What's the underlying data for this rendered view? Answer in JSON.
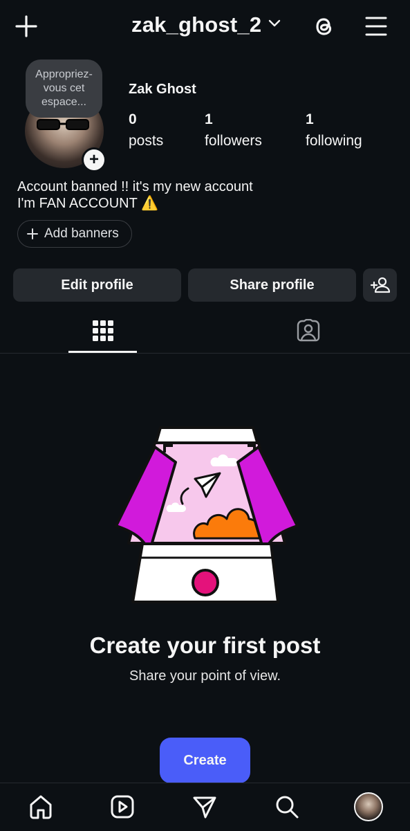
{
  "header": {
    "username": "zak_ghost_2",
    "icons": [
      "plus-icon",
      "chevron-down-icon",
      "threads-icon",
      "menu-icon"
    ]
  },
  "profile": {
    "note": "Appropriez-vous cet espace...",
    "display_name": "Zak Ghost",
    "stats": [
      {
        "value": "0",
        "label": "posts"
      },
      {
        "value": "1",
        "label": "followers"
      },
      {
        "value": "1",
        "label": "following"
      }
    ],
    "bio_line1": "Account banned !! it's my new account",
    "bio_line2": "I'm FAN ACCOUNT ⚠️",
    "add_banners": "Add banners"
  },
  "actions": {
    "edit_profile": "Edit profile",
    "share_profile": "Share profile"
  },
  "tabs": [
    "grid-icon",
    "tagged-icon"
  ],
  "empty_state": {
    "title": "Create your first post",
    "subtitle": "Share your point of view.",
    "button": "Create"
  },
  "nav": [
    "home-icon",
    "reels-icon",
    "direct-icon",
    "search-icon",
    "profile-avatar"
  ],
  "colors": {
    "background": "#0c1014",
    "button_bg": "#25292e",
    "accent": "#4a5df9",
    "magenta": "#d11adb",
    "orange": "#fb7b0b"
  }
}
